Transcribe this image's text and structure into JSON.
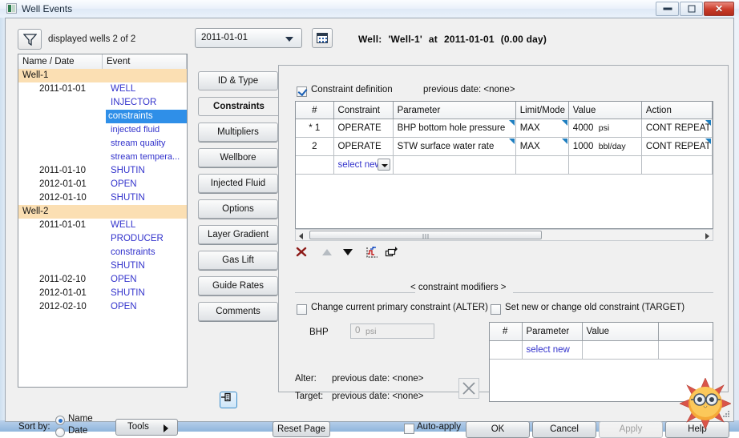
{
  "window": {
    "title": "Well Events",
    "icon": "app-icon",
    "controls": {
      "minimize": "–",
      "maximize": "□",
      "close": "✕"
    }
  },
  "toolbar": {
    "filter_icon": "filter-icon",
    "displayed_wells": "displayed wells 2 of 2",
    "date_combo": {
      "value": "2011-01-01",
      "arrow": "chevron-down-icon"
    },
    "date_grid_icon": "calendar-grid-icon",
    "well_header": {
      "label": "Well:",
      "name": "'Well-1'",
      "at": "at",
      "date": "2011-01-01",
      "elapsed": "(0.00 day)"
    }
  },
  "tree": {
    "columns": [
      "Name / Date",
      "Event"
    ],
    "rows": [
      {
        "type": "well",
        "name": "Well-1",
        "date": "",
        "event": ""
      },
      {
        "type": "event",
        "name": "",
        "date": "2011-01-01",
        "event": "WELL"
      },
      {
        "type": "event",
        "name": "",
        "date": "",
        "event": "INJECTOR"
      },
      {
        "type": "event",
        "name": "",
        "date": "",
        "event": "constraints",
        "selected": true
      },
      {
        "type": "event",
        "name": "",
        "date": "",
        "event": "injected fluid"
      },
      {
        "type": "event",
        "name": "",
        "date": "",
        "event": "stream quality"
      },
      {
        "type": "event",
        "name": "",
        "date": "",
        "event": "stream tempera..."
      },
      {
        "type": "event",
        "name": "",
        "date": "2011-01-10",
        "event": "SHUTIN"
      },
      {
        "type": "event",
        "name": "",
        "date": "2012-01-01",
        "event": "OPEN"
      },
      {
        "type": "event",
        "name": "",
        "date": "2012-01-10",
        "event": "SHUTIN"
      },
      {
        "type": "well",
        "name": "Well-2",
        "date": "",
        "event": ""
      },
      {
        "type": "event",
        "name": "",
        "date": "2011-01-01",
        "event": "WELL"
      },
      {
        "type": "event",
        "name": "",
        "date": "",
        "event": "PRODUCER"
      },
      {
        "type": "event",
        "name": "",
        "date": "",
        "event": "constraints"
      },
      {
        "type": "event",
        "name": "",
        "date": "",
        "event": "SHUTIN"
      },
      {
        "type": "event",
        "name": "",
        "date": "2011-02-10",
        "event": "OPEN"
      },
      {
        "type": "event",
        "name": "",
        "date": "2012-01-01",
        "event": "SHUTIN"
      },
      {
        "type": "event",
        "name": "",
        "date": "2012-02-10",
        "event": "OPEN"
      }
    ]
  },
  "sort": {
    "label": "Sort by:",
    "options": [
      "Name",
      "Date"
    ],
    "selected": "Name"
  },
  "tools_button": {
    "label": "Tools",
    "arrow": "triangle-right-icon"
  },
  "pin_button": {
    "icon": "pin-icon"
  },
  "tabs": [
    {
      "label": "ID & Type",
      "active": false
    },
    {
      "label": "Constraints",
      "active": true
    },
    {
      "label": "Multipliers",
      "active": false
    },
    {
      "label": "Wellbore",
      "active": false
    },
    {
      "label": "Injected Fluid",
      "active": false
    },
    {
      "label": "Options",
      "active": false
    },
    {
      "label": "Layer Gradient",
      "active": false
    },
    {
      "label": "Gas Lift",
      "active": false
    },
    {
      "label": "Guide Rates",
      "active": false
    },
    {
      "label": "Comments",
      "active": false
    }
  ],
  "constraints": {
    "checkbox_label": "Constraint definition",
    "checkbox_checked": true,
    "previous_date": "previous date: <none>",
    "columns": [
      "#",
      "Constraint",
      "Parameter",
      "Limit/Mode",
      "Value",
      "Action"
    ],
    "rows": [
      {
        "num": "* 1",
        "constraint": "OPERATE",
        "parameter": "BHP bottom hole pressure",
        "limit": "MAX",
        "value": "4000",
        "unit": "psi",
        "action": "CONT REPEAT"
      },
      {
        "num": "2",
        "constraint": "OPERATE",
        "parameter": "STW surface water rate",
        "limit": "MAX",
        "value": "1000",
        "unit": "bbl/day",
        "action": "CONT REPEAT"
      }
    ],
    "new_row_label": "select new",
    "icons": {
      "delete": "delete-x-icon",
      "move_up": "arrow-up-icon",
      "move_down": "arrow-down-icon",
      "chart": "plot-chart-icon",
      "copy": "copy-windows-icon"
    }
  },
  "modifiers": {
    "section_title": "< constraint modifiers >",
    "alter": {
      "checkbox_label": "Change current primary constraint (ALTER)",
      "checked": false,
      "field_label": "BHP",
      "field_value": "0",
      "field_unit": "psi"
    },
    "target": {
      "checkbox_label": "Set new or change old constraint (TARGET)",
      "checked": false,
      "columns": [
        "#",
        "Parameter",
        "Value"
      ],
      "new_row_label": "select new"
    },
    "alter_prev_label": "Alter:",
    "alter_prev_value": "previous date: <none>",
    "target_prev_label": "Target:",
    "target_prev_value": "previous date: <none>",
    "clear_icon": "clear-x-icon"
  },
  "footer": {
    "reset": "Reset Page",
    "autoapply_label": "Auto-apply",
    "autoapply_checked": false,
    "ok": "OK",
    "cancel": "Cancel",
    "apply": "Apply",
    "help": "Help"
  },
  "colors": {
    "accent_blue": "#2f8fe8",
    "link_blue": "#3333cc",
    "well_row": "#fbdfb3",
    "flag_teal": "#1f7fc0",
    "close_red": "#c93a28"
  }
}
